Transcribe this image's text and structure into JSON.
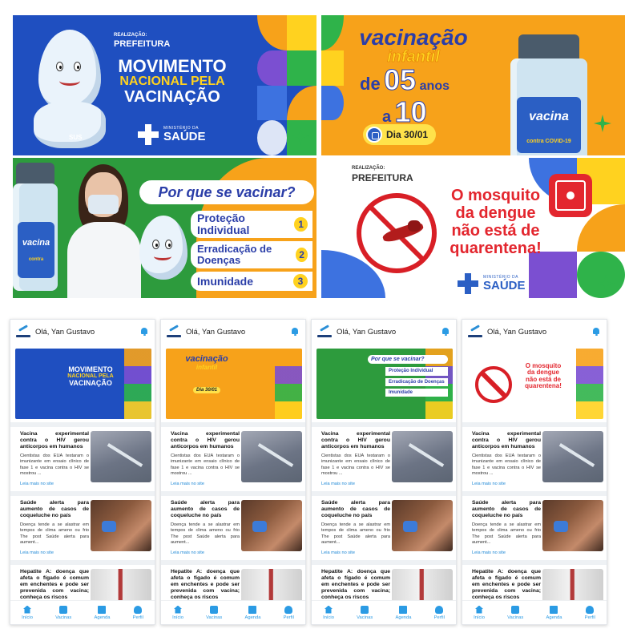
{
  "banners": {
    "movimento": {
      "realizacao": "REALIZAÇÃO:",
      "org": "PREFEITURA",
      "line1": "MOVIMENTO",
      "line2": "NACIONAL PELA",
      "line3": "VACINAÇÃO",
      "sus": "SUS",
      "ministerio": "MINISTÉRIO DA",
      "saude": "SAÚDE"
    },
    "infantil": {
      "line1": "vacinação",
      "line2": "infantil",
      "line3a": "de",
      "line3b": "05",
      "line3c": "anos",
      "line4a": "a",
      "line4b": "10",
      "date": "Dia 30/01",
      "vial_label": "vacina",
      "vial_sub": "contra COVID-19"
    },
    "porque": {
      "title": "Por que se vacinar?",
      "items": [
        {
          "label": "Proteção Individual",
          "num": "1"
        },
        {
          "label": "Erradicação de Doenças",
          "num": "2"
        },
        {
          "label": "Imunidade",
          "num": "3"
        }
      ],
      "vial_label": "vacina",
      "vial_sub": "contra"
    },
    "dengue": {
      "realizacao": "REALIZAÇÃO:",
      "org": "PREFEITURA",
      "line1": "O mosquito",
      "line2": "da dengue",
      "line3": "não está de",
      "line4": "quarentena!",
      "ministerio": "MINISTÉRIO DA",
      "saude": "SAÚDE"
    }
  },
  "app": {
    "greeting": "Olá, Yan Gustavo",
    "news": [
      {
        "title": "Vacina experimental contra o HIV gerou anticorpos em humanos",
        "excerpt": "Cientistas dos EUA testaram o imunizante em ensaio clínico de fase 1 e vacina contra o HIV se mostrou ...",
        "more": "Leia mais no site"
      },
      {
        "title": "Saúde alerta para aumento de casos de coqueluche no país",
        "excerpt": "Doença tende a se alastrar em tempos de clima ameno ou frio The post Saúde alerta para aument...",
        "more": "Leia mais no site"
      },
      {
        "title": "Hepatite A: doença que afeta o fígado é comum em enchentes e pode ser prevenida com vacina; conheça os riscos",
        "excerpt": "",
        "more": ""
      }
    ],
    "tabs": [
      {
        "label": "Início",
        "icon": "home-icon"
      },
      {
        "label": "Vacinas",
        "icon": "vaccine-kit-icon"
      },
      {
        "label": "Agenda",
        "icon": "calendar-icon"
      },
      {
        "label": "Perfil",
        "icon": "user-icon"
      }
    ]
  },
  "colors": {
    "blue_banner": "#1f4fc0",
    "orange_banner": "#f7a21a",
    "green_banner": "#2d9b3d",
    "accent": "#2b9be4",
    "link": "#1e88d6",
    "dengue_red": "#e3262e"
  }
}
